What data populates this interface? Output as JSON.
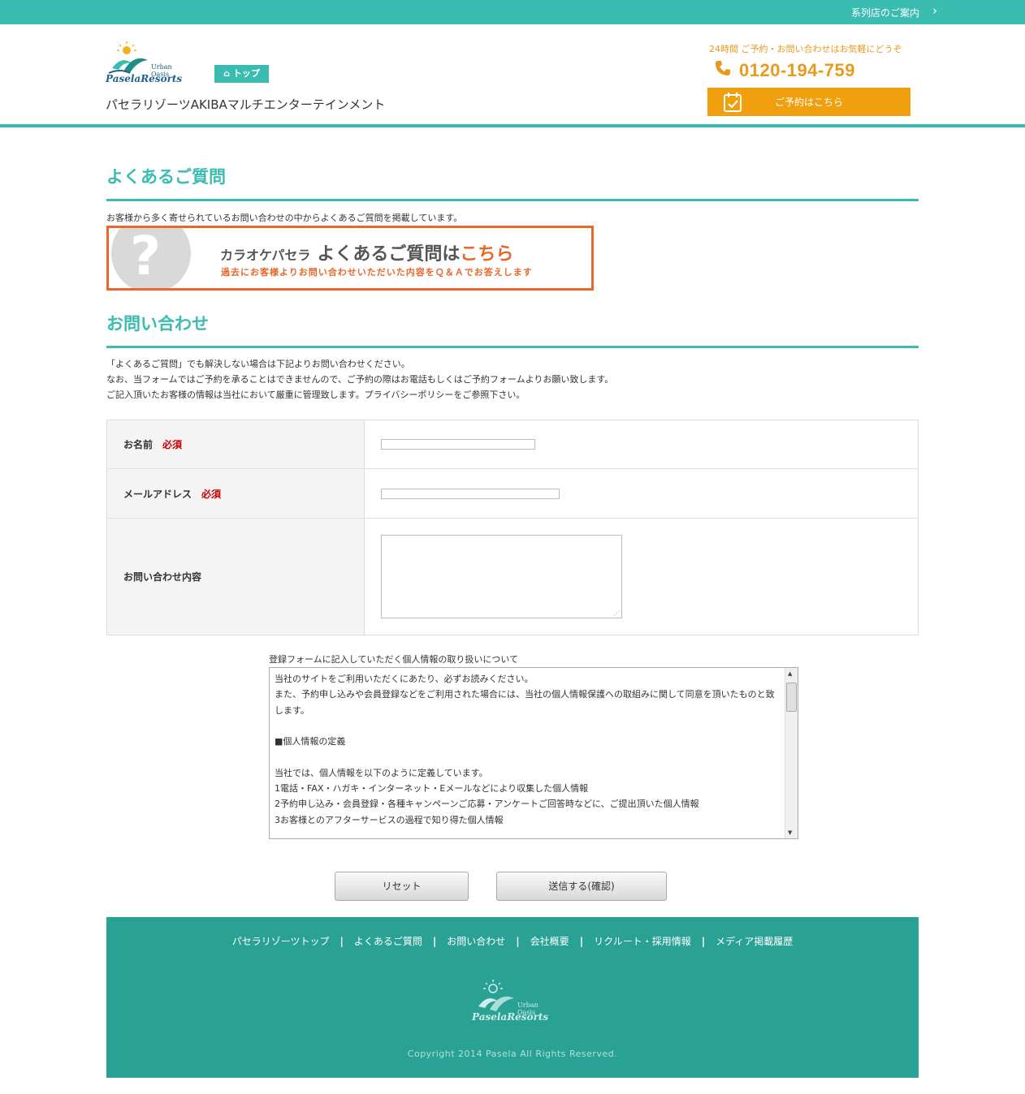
{
  "topbar": {
    "group_link": "系列店のご案内",
    "chevron": "›"
  },
  "header": {
    "logo_small": "Urban Oasis",
    "logo_script": "PaselaResorts",
    "top_button": "トップ",
    "site_name": "パセラリゾーツAKIBAマルチエンターテインメント",
    "hours": "24時間 ご予約・お問い合わせはお気軽にどうぞ",
    "phone": "0120-194-759",
    "reserve": "ご予約はこちら"
  },
  "faq": {
    "title": "よくあるご質問",
    "intro": "お客様から多く寄せられているお問い合わせの中からよくあるご質問を掲載しています。",
    "banner_prefix": "カラオケパセラ",
    "banner_main": "よくあるご質問は",
    "banner_accent": "こちら",
    "banner_sub": "過去にお客様よりお問い合わせいただいた内容をＱ＆Ａでお答えします",
    "banner_q": "?"
  },
  "contact": {
    "title": "お問い合わせ",
    "lines": [
      "「よくあるご質問」でも解決しない場合は下記よりお問い合わせください。",
      "なお、当フォームではご予約を承ることはできませんので、ご予約の際はお電話もしくはご予約フォームよりお願い致します。",
      "ご記入頂いたお客様の情報は当社において厳重に管理致します。プライバシーポリシーをご参照下さい。"
    ],
    "fields": {
      "name_label": "お名前",
      "email_label": "メールアドレス",
      "message_label": "お問い合わせ内容",
      "required": "必須",
      "name_value": "",
      "email_value": "",
      "message_value": ""
    },
    "privacy_label": "登録フォームに記入していただく個人情報の取り扱いについて",
    "privacy_lines": [
      "当社のサイトをご利用いただくにあたり、必ずお読みください。",
      "また、予約申し込みや会員登録などをご利用された場合には、当社の個人情報保護への取組みに関して同意を頂いたものと致します。",
      "",
      "■個人情報の定義",
      "",
      "当社では、個人情報を以下のように定義しています。",
      "1電話・FAX・ハガキ・インターネット・Eメールなどにより収集した個人情報",
      "2予約申し込み・会員登録・各種キャンペーンご応募・アンケートご回答時などに、ご提出頂いた個人情報",
      "3お客様とのアフターサービスの過程で知り得た個人情報"
    ],
    "reset_button": "リセット",
    "submit_button": "送信する(確認)"
  },
  "footer": {
    "nav": [
      "パセラリゾーツトップ",
      "よくあるご質問",
      "お問い合わせ",
      "会社概要",
      "リクルート・採用情報",
      "メディア掲載履歴"
    ],
    "separator": "|",
    "logo_small": "Urban Oasis",
    "logo_script": "PaselaResorts",
    "copyright": "Copyright 2014 Pasela All Rights Reserved."
  },
  "colors": {
    "teal": "#3bbcb0",
    "footer_teal": "#2aa195",
    "orange": "#f0a00e",
    "banner_orange": "#e8672a",
    "required_red": "#cc0000"
  }
}
